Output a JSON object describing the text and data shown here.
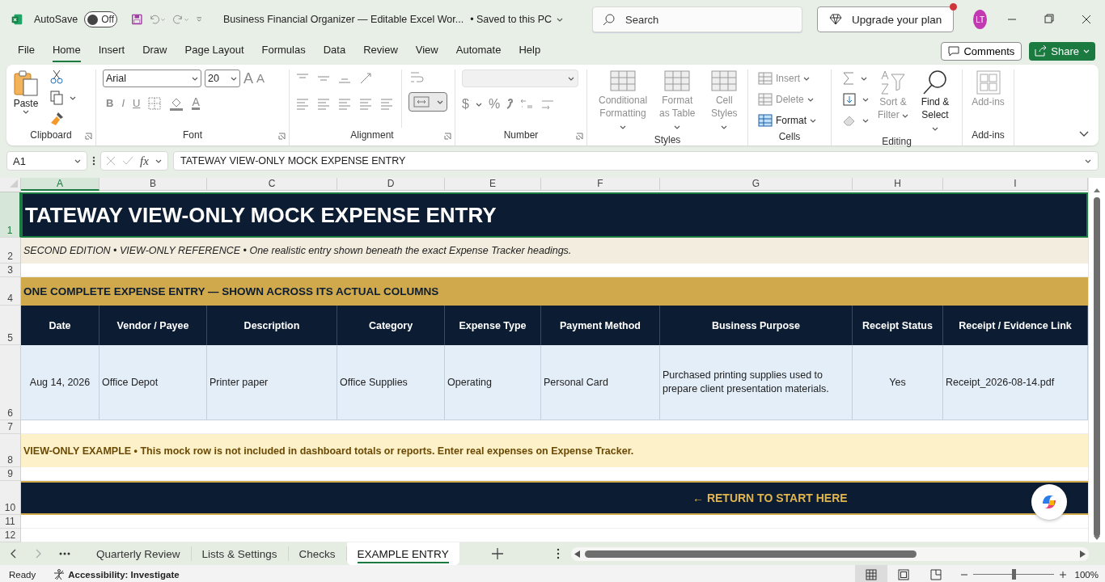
{
  "title_bar": {
    "autosave": {
      "label": "AutoSave",
      "state_text": "Off",
      "on": false
    },
    "document_title": "Business Financial Organizer — Editable Excel Wor...",
    "save_status": "• Saved to this PC",
    "search": {
      "placeholder": "Search"
    },
    "upgrade_button": "Upgrade your plan",
    "avatar": "LT"
  },
  "menu_tabs": [
    {
      "label": "File",
      "selected": false
    },
    {
      "label": "Home",
      "selected": true
    },
    {
      "label": "Insert",
      "selected": false
    },
    {
      "label": "Draw",
      "selected": false
    },
    {
      "label": "Page Layout",
      "selected": false
    },
    {
      "label": "Formulas",
      "selected": false
    },
    {
      "label": "Data",
      "selected": false
    },
    {
      "label": "Review",
      "selected": false
    },
    {
      "label": "View",
      "selected": false
    },
    {
      "label": "Automate",
      "selected": false
    },
    {
      "label": "Help",
      "selected": false
    }
  ],
  "comments_button": "Comments",
  "share_button": "Share",
  "ribbon": {
    "groups": [
      {
        "kind": "clipboard",
        "label": "Clipboard",
        "paste": "Paste"
      },
      {
        "kind": "font",
        "label": "Font",
        "font_name": "Arial",
        "font_size": "20",
        "size_buttons": [
          "A",
          "A"
        ],
        "style_buttons": [
          {
            "kind": "bold",
            "label": "B"
          },
          {
            "kind": "italic",
            "label": "I"
          },
          {
            "kind": "underline",
            "label": "U"
          }
        ],
        "font_color": "A"
      },
      {
        "kind": "alignment",
        "label": "Alignment",
        "merge_selected": true
      },
      {
        "kind": "number",
        "label": "Number",
        "currency": "$",
        "percent": "%"
      },
      {
        "kind": "styles",
        "label": "Styles",
        "buttons": [
          {
            "label": "Conditional Formatting",
            "disabled": true
          },
          {
            "label": "Format as Table",
            "disabled": true
          },
          {
            "label": "Cell Styles",
            "disabled": true
          }
        ]
      },
      {
        "kind": "cells",
        "label": "Cells",
        "buttons": [
          {
            "label": "Insert",
            "disabled": true
          },
          {
            "label": "Delete",
            "disabled": true
          },
          {
            "label": "Format",
            "disabled": false
          }
        ]
      },
      {
        "kind": "editing",
        "label": "Editing",
        "buttons": [
          {
            "label": "Sort & Filter",
            "disabled": true
          },
          {
            "label": "Find & Select",
            "disabled": false
          }
        ]
      },
      {
        "kind": "addins",
        "label": "Add-ins",
        "buttons": [
          {
            "label": "Add-ins",
            "disabled": true
          }
        ]
      }
    ]
  },
  "formula_bar": {
    "name_box": "A1",
    "fx": "fx",
    "formula": "TATEWAY VIEW-ONLY MOCK EXPENSE ENTRY"
  },
  "sheet": {
    "columns": [
      {
        "letter": "A",
        "selected": true
      },
      {
        "letter": "B",
        "selected": false
      },
      {
        "letter": "C",
        "selected": false
      },
      {
        "letter": "D",
        "selected": false
      },
      {
        "letter": "E",
        "selected": false
      },
      {
        "letter": "F",
        "selected": false
      },
      {
        "letter": "G",
        "selected": false
      },
      {
        "letter": "H",
        "selected": false
      },
      {
        "letter": "I",
        "selected": false
      }
    ],
    "rows": [
      {
        "number": "1",
        "selected": true,
        "kind": "title",
        "text": "TATEWAY VIEW-ONLY MOCK EXPENSE ENTRY"
      },
      {
        "number": "2",
        "selected": false,
        "kind": "subtitle",
        "text": "SECOND EDITION • VIEW-ONLY REFERENCE • One realistic entry shown beneath the exact Expense Tracker headings."
      },
      {
        "number": "3",
        "selected": false,
        "kind": "blank"
      },
      {
        "number": "4",
        "selected": false,
        "kind": "section",
        "text": "ONE COMPLETE EXPENSE ENTRY — SHOWN ACROSS ITS ACTUAL COLUMNS"
      },
      {
        "number": "5",
        "selected": false,
        "kind": "header",
        "cells": [
          "Date",
          "Vendor / Payee",
          "Description",
          "Category",
          "Expense Type",
          "Payment Method",
          "Business Purpose",
          "Receipt Status",
          "Receipt / Evidence Link"
        ]
      },
      {
        "number": "6",
        "selected": false,
        "kind": "data",
        "cells": [
          "Aug 14, 2026",
          "Office Depot",
          "Printer paper",
          "Office Supplies",
          "Operating",
          "Personal Card",
          "Purchased printing supplies used to prepare client presentation materials.",
          "Yes",
          "Receipt_2026-08-14.pdf"
        ]
      },
      {
        "number": "7",
        "selected": false,
        "kind": "blank"
      },
      {
        "number": "8",
        "selected": false,
        "kind": "note",
        "text": "VIEW-ONLY EXAMPLE • This mock row is not included in dashboard totals or reports. Enter real expenses on Expense Tracker."
      },
      {
        "number": "9",
        "selected": false,
        "kind": "blank"
      },
      {
        "number": "10",
        "selected": false,
        "kind": "link",
        "link": "← RETURN TO START HERE"
      },
      {
        "number": "11",
        "selected": false,
        "kind": "blank"
      },
      {
        "number": "12",
        "selected": false,
        "kind": "blank"
      }
    ]
  },
  "sheet_tabs": [
    {
      "label": "Quarterly Review",
      "selected": false
    },
    {
      "label": "Lists & Settings",
      "selected": false
    },
    {
      "label": "Checks",
      "selected": false
    },
    {
      "label": "EXAMPLE ENTRY",
      "selected": true
    }
  ],
  "status_bar": {
    "status": "Ready",
    "accessibility": "Accessibility: Investigate",
    "views": [
      {
        "kind": "normal",
        "selected": true
      },
      {
        "kind": "page_layout",
        "selected": false
      },
      {
        "kind": "page_break",
        "selected": false
      }
    ],
    "zoom_slider": {
      "level": 0.5
    },
    "zoom": "100%"
  }
}
